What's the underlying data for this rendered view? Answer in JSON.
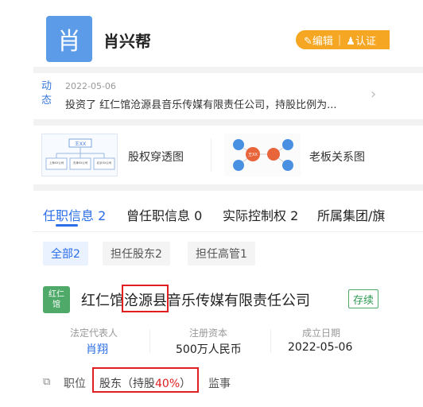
{
  "header": {
    "avatar_char": "肖",
    "name": "肖兴帮",
    "edit_label": "✎编辑",
    "verify_label": "♟认证"
  },
  "dynamic": {
    "tag_line1": "动",
    "tag_line2": "态",
    "date": "2022-05-06",
    "text": "投资了 红仁馆沧源县音乐传媒有限责任公司，持股比例为..."
  },
  "graphs": {
    "equity_label": "股权穿透图",
    "boss_label": "老板关系图",
    "equity_thumb_top": "王XX",
    "equity_thumb_children": [
      "上海XX公司",
      "天津XX公司",
      "北京XX公司"
    ],
    "boss_thumb_center": "王XX"
  },
  "tabs": [
    {
      "label": "任职信息 2"
    },
    {
      "label": "曾任职信息 0"
    },
    {
      "label": "实际控制权 2"
    },
    {
      "label": "所属集团/旗"
    }
  ],
  "chips": [
    {
      "label": "全部2"
    },
    {
      "label": "担任股东2"
    },
    {
      "label": "担任高管1"
    }
  ],
  "company": {
    "logo_line1": "红仁",
    "logo_line2": "馆",
    "name": "红仁馆沧源县音乐传媒有限责任公司",
    "status": "存续",
    "legal_rep_label": "法定代表人",
    "legal_rep_value": "肖翔",
    "capital_label": "注册资本",
    "capital_value": "500万人民币",
    "date_label": "成立日期",
    "date_value": "2022-05-06",
    "role_prefix": "职位",
    "role_text": "股东（持股",
    "role_percent": "40%",
    "role_suffix": "）",
    "role_extra": "监事"
  },
  "colors": {
    "accent": "#2a6ee8",
    "highlight": "#e02020",
    "status_green": "#4faa6a",
    "edit_orange": "#f5a623"
  }
}
